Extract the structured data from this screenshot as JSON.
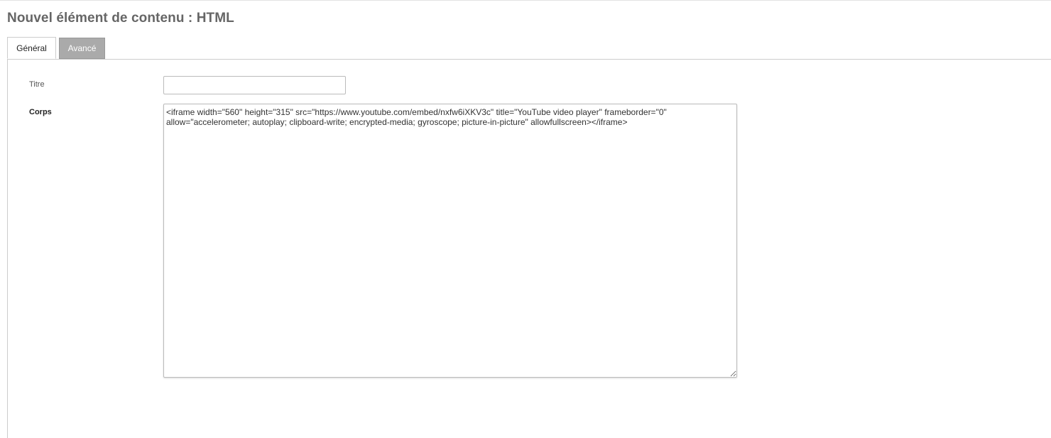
{
  "page": {
    "title": "Nouvel élément de contenu : HTML"
  },
  "tabs": [
    {
      "label": "Général",
      "active": true
    },
    {
      "label": "Avancé",
      "active": false
    }
  ],
  "form": {
    "title_field": {
      "label": "Titre",
      "value": ""
    },
    "body_field": {
      "label": "Corps",
      "value": "<iframe width=\"560\" height=\"315\" src=\"https://www.youtube.com/embed/nxfw6iXKV3c\" title=\"YouTube video player\" frameborder=\"0\" allow=\"accelerometer; autoplay; clipboard-write; encrypted-media; gyroscope; picture-in-picture\" allowfullscreen></iframe>"
    }
  },
  "colors": {
    "title_text": "#666666",
    "inactive_tab_bg": "#aaaaaa",
    "border": "#cccccc"
  }
}
